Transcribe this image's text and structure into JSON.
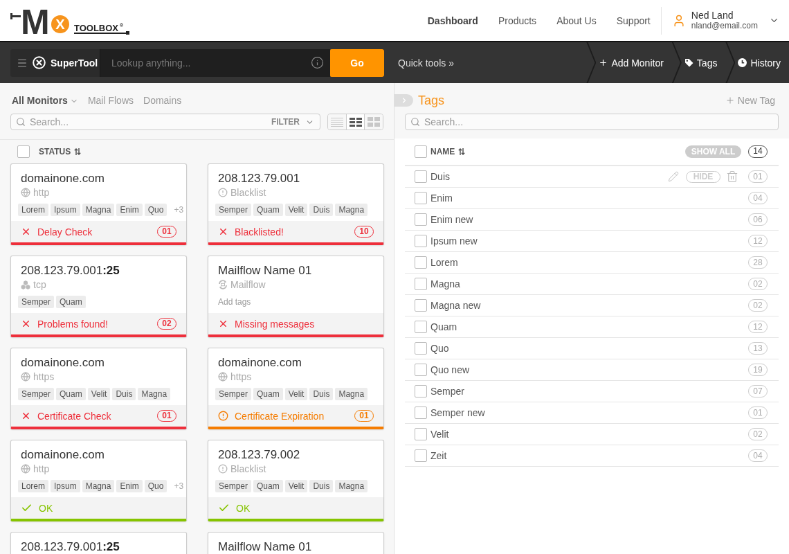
{
  "header": {
    "logo": {
      "letter": "M",
      "badge": "X",
      "wordmark": "TOOLBOX",
      "trademark": "®"
    },
    "nav": [
      {
        "label": "Dashboard",
        "selected": true
      },
      {
        "label": "Products",
        "selected": false
      },
      {
        "label": "About Us",
        "selected": false
      },
      {
        "label": "Support",
        "selected": false
      }
    ],
    "user": {
      "name": "Ned Land",
      "email": "nland@email.com"
    }
  },
  "toolbar": {
    "supertool": "SuperTool",
    "lookup": {
      "placeholder": "Lookup anything..."
    },
    "go": "Go",
    "quick_tools": "Quick tools »",
    "actions": [
      {
        "kind": "add",
        "label": "Add Monitor"
      },
      {
        "kind": "tag",
        "label": "Tags"
      },
      {
        "kind": "history",
        "label": "History"
      }
    ]
  },
  "monitors": {
    "tabs": [
      {
        "label": "All Monitors",
        "selected": true,
        "menu": true
      },
      {
        "label": "Mail Flows",
        "selected": false
      },
      {
        "label": "Domains",
        "selected": false
      }
    ],
    "search": {
      "placeholder": "Search..."
    },
    "filter": "FILTER",
    "views": [
      {
        "kind": "list",
        "selected": false
      },
      {
        "kind": "grid",
        "selected": true
      },
      {
        "kind": "tiles",
        "selected": false
      }
    ],
    "header": {
      "checked": false,
      "label": "STATUS"
    },
    "cards": [
      {
        "title": "domainone.com",
        "type": {
          "kind": "web",
          "label": "http"
        },
        "tags": [
          "Lorem",
          "Ipsum",
          "Magna",
          "Enim",
          "Quo"
        ],
        "more": "+3",
        "status": {
          "kind": "error",
          "label": "Delay Check",
          "count": "01"
        }
      },
      {
        "title": "208.123.79.001",
        "type": {
          "kind": "blacklist",
          "label": "Blacklist"
        },
        "tags": [
          "Semper",
          "Quam",
          "Velit",
          "Duis",
          "Magna"
        ],
        "status": {
          "kind": "error",
          "label": "Blacklisted!",
          "count": "10"
        }
      },
      {
        "title": "208.123.79.001**:25**",
        "type": {
          "kind": "tcp",
          "label": "tcp"
        },
        "tags": [
          "Semper",
          "Quam"
        ],
        "status": {
          "kind": "error",
          "label": "Problems found!",
          "count": "02"
        }
      },
      {
        "title": "Mailflow Name 01",
        "type": {
          "kind": "mailflow",
          "label": "Mailflow"
        },
        "add_tags": "Add tags",
        "status": {
          "kind": "error",
          "label": "Missing messages"
        }
      },
      {
        "title": "domainone.com",
        "type": {
          "kind": "web",
          "label": "https"
        },
        "tags": [
          "Semper",
          "Quam",
          "Velit",
          "Duis",
          "Magna"
        ],
        "status": {
          "kind": "error",
          "label": "Certificate Check",
          "count": "01"
        }
      },
      {
        "title": "domainone.com",
        "type": {
          "kind": "web",
          "label": "https"
        },
        "tags": [
          "Semper",
          "Quam",
          "Velit",
          "Duis",
          "Magna"
        ],
        "status": {
          "kind": "warning",
          "label": "Certificate Expiration",
          "count": "01"
        }
      },
      {
        "title": "domainone.com",
        "type": {
          "kind": "web",
          "label": "http"
        },
        "tags": [
          "Lorem",
          "Ipsum",
          "Magna",
          "Enim",
          "Quo"
        ],
        "more": "+3",
        "status": {
          "kind": "ok",
          "label": "OK"
        }
      },
      {
        "title": "208.123.79.002",
        "type": {
          "kind": "blacklist",
          "label": "Blacklist"
        },
        "tags": [
          "Semper",
          "Quam",
          "Velit",
          "Duis",
          "Magna"
        ],
        "status": {
          "kind": "ok",
          "label": "OK"
        }
      },
      {
        "title": "208.123.79.001**:25**"
      },
      {
        "title": "Mailflow Name 01"
      }
    ]
  },
  "tags": {
    "title": "Tags",
    "new_tag": "New Tag",
    "search": {
      "placeholder": "Search..."
    },
    "header": {
      "checked": false,
      "label": "NAME",
      "show_all": "SHOW ALL",
      "count": "14"
    },
    "rows": [
      {
        "name": "Duis",
        "count": "01",
        "checked": false,
        "actions": {
          "hide": "HIDE"
        }
      },
      {
        "name": "Enim",
        "count": "04",
        "checked": false
      },
      {
        "name": "Enim new",
        "count": "06",
        "checked": false
      },
      {
        "name": "Ipsum new",
        "count": "12",
        "checked": false
      },
      {
        "name": "Lorem",
        "count": "28",
        "checked": false
      },
      {
        "name": "Magna",
        "count": "02",
        "checked": false
      },
      {
        "name": "Magna new",
        "count": "02",
        "checked": false
      },
      {
        "name": "Quam",
        "count": "12",
        "checked": false
      },
      {
        "name": "Quo",
        "count": "13",
        "checked": false
      },
      {
        "name": "Quo new",
        "count": "19",
        "checked": false
      },
      {
        "name": "Semper",
        "count": "07",
        "checked": false
      },
      {
        "name": "Semper new",
        "count": "01",
        "checked": false
      },
      {
        "name": "Velit",
        "count": "02",
        "checked": false
      },
      {
        "name": "Zeit",
        "count": "04",
        "checked": false
      }
    ]
  }
}
